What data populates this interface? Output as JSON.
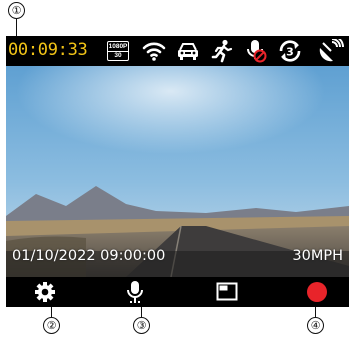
{
  "callouts": {
    "c1": "①",
    "c2": "②",
    "c3": "③",
    "c4": "④"
  },
  "status_bar": {
    "recording_time": "00:09:33",
    "resolution_badge": {
      "line1": "1080P",
      "line2": "30"
    },
    "icons": [
      "wifi-icon",
      "parking-mode-car-icon",
      "motion-detection-icon",
      "audio-muted-icon",
      "loop-recording-3min-icon",
      "gps-satellite-icon"
    ],
    "loop_minutes": "3"
  },
  "overlay": {
    "datetime": "01/10/2022 09:00:00",
    "speed": "30MPH"
  },
  "softkeys": [
    {
      "name": "settings-button",
      "icon": "gear-icon"
    },
    {
      "name": "microphone-button",
      "icon": "microphone-icon"
    },
    {
      "name": "screen-mode-button",
      "icon": "window-icon"
    },
    {
      "name": "record-button",
      "icon": "record-dot-icon"
    }
  ],
  "colors": {
    "timer": "#f2c417",
    "record": "#e8242a",
    "mute_slash": "#e8242a"
  }
}
